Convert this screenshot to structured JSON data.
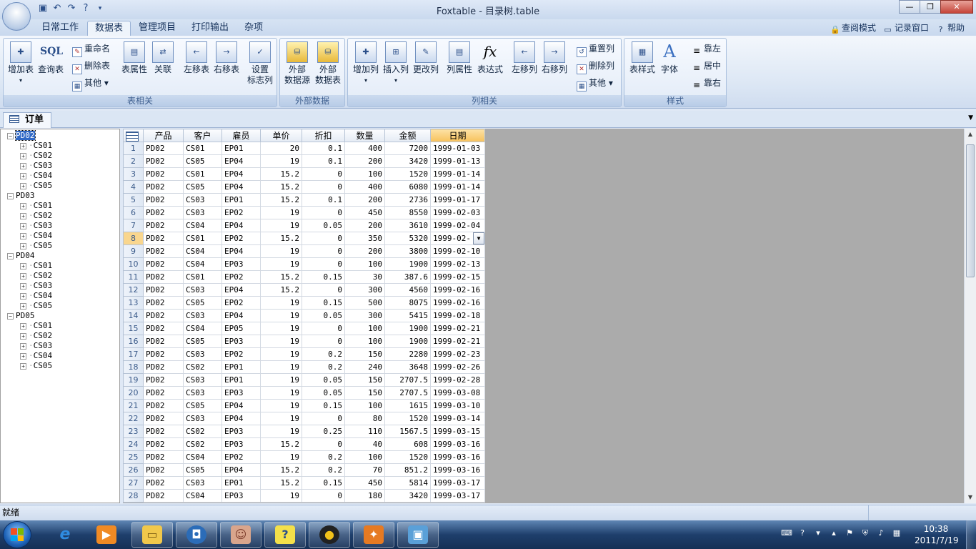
{
  "window": {
    "title": "Foxtable - 目录树.table",
    "minimize_label": "—",
    "maximize_label": "❐",
    "close_label": "✕"
  },
  "ribbon_tabs": [
    "日常工作",
    "数据表",
    "管理项目",
    "打印输出",
    "杂项"
  ],
  "active_tab": "数据表",
  "ribbon_right": {
    "query_mode": "查阅模式",
    "log_window": "记录窗口",
    "help": "帮助"
  },
  "groups": {
    "table": {
      "caption": "表相关",
      "add_table": "增加表",
      "query_table": "查询表",
      "sql_label": "SQL",
      "rename": "重命名",
      "delete_table": "删除表",
      "other": "其他",
      "table_props": "表属性",
      "relation": "关联",
      "move_left": "左移表",
      "move_right": "右移表",
      "set_flag_col": "设置\n标志列"
    },
    "external": {
      "caption": "外部数据",
      "ext_source": "外部\n数据源",
      "ext_table": "外部\n数据表"
    },
    "columns": {
      "caption": "列相关",
      "add_col": "增加列",
      "insert_col": "插入列",
      "change_col": "更改列",
      "col_props": "列属性",
      "expression": "表达式",
      "fx_label": "fx",
      "move_col_left": "左移列",
      "move_col_right": "右移列",
      "reset_col": "重置列",
      "delete_col": "删除列",
      "other": "其他"
    },
    "style": {
      "caption": "样式",
      "table_style": "表样式",
      "font": "字体",
      "font_glyph": "A",
      "align_left": "靠左",
      "align_center": "居中",
      "align_right": "靠右"
    }
  },
  "doc_tab": "订单",
  "tree": [
    {
      "label": "PD02",
      "selected": true,
      "children": [
        "CS01",
        "CS02",
        "CS03",
        "CS04",
        "CS05"
      ]
    },
    {
      "label": "PD03",
      "selected": false,
      "children": [
        "CS01",
        "CS02",
        "CS03",
        "CS04",
        "CS05"
      ]
    },
    {
      "label": "PD04",
      "selected": false,
      "children": [
        "CS01",
        "CS02",
        "CS03",
        "CS04",
        "CS05"
      ]
    },
    {
      "label": "PD05",
      "selected": false,
      "children": [
        "CS01",
        "CS02",
        "CS03",
        "CS04",
        "CS05"
      ]
    }
  ],
  "table": {
    "columns": [
      "产品",
      "客户",
      "雇员",
      "单价",
      "折扣",
      "数量",
      "金额",
      "日期"
    ],
    "selected_column": "日期",
    "current_row": 8,
    "rows": [
      [
        "PD02",
        "CS01",
        "EP01",
        "20",
        "0.1",
        "400",
        "7200",
        "1999-01-03"
      ],
      [
        "PD02",
        "CS05",
        "EP04",
        "19",
        "0.1",
        "200",
        "3420",
        "1999-01-13"
      ],
      [
        "PD02",
        "CS01",
        "EP04",
        "15.2",
        "0",
        "100",
        "1520",
        "1999-01-14"
      ],
      [
        "PD02",
        "CS05",
        "EP04",
        "15.2",
        "0",
        "400",
        "6080",
        "1999-01-14"
      ],
      [
        "PD02",
        "CS03",
        "EP01",
        "15.2",
        "0.1",
        "200",
        "2736",
        "1999-01-17"
      ],
      [
        "PD02",
        "CS03",
        "EP02",
        "19",
        "0",
        "450",
        "8550",
        "1999-02-03"
      ],
      [
        "PD02",
        "CS04",
        "EP04",
        "19",
        "0.05",
        "200",
        "3610",
        "1999-02-04"
      ],
      [
        "PD02",
        "CS01",
        "EP02",
        "15.2",
        "0",
        "350",
        "5320",
        "1999-02-"
      ],
      [
        "PD02",
        "CS04",
        "EP04",
        "19",
        "0",
        "200",
        "3800",
        "1999-02-10"
      ],
      [
        "PD02",
        "CS04",
        "EP03",
        "19",
        "0",
        "100",
        "1900",
        "1999-02-13"
      ],
      [
        "PD02",
        "CS01",
        "EP02",
        "15.2",
        "0.15",
        "30",
        "387.6",
        "1999-02-15"
      ],
      [
        "PD02",
        "CS03",
        "EP04",
        "15.2",
        "0",
        "300",
        "4560",
        "1999-02-16"
      ],
      [
        "PD02",
        "CS05",
        "EP02",
        "19",
        "0.15",
        "500",
        "8075",
        "1999-02-16"
      ],
      [
        "PD02",
        "CS03",
        "EP04",
        "19",
        "0.05",
        "300",
        "5415",
        "1999-02-18"
      ],
      [
        "PD02",
        "CS04",
        "EP05",
        "19",
        "0",
        "100",
        "1900",
        "1999-02-21"
      ],
      [
        "PD02",
        "CS05",
        "EP03",
        "19",
        "0",
        "100",
        "1900",
        "1999-02-21"
      ],
      [
        "PD02",
        "CS03",
        "EP02",
        "19",
        "0.2",
        "150",
        "2280",
        "1999-02-23"
      ],
      [
        "PD02",
        "CS02",
        "EP01",
        "19",
        "0.2",
        "240",
        "3648",
        "1999-02-26"
      ],
      [
        "PD02",
        "CS03",
        "EP01",
        "19",
        "0.05",
        "150",
        "2707.5",
        "1999-02-28"
      ],
      [
        "PD02",
        "CS03",
        "EP03",
        "19",
        "0.05",
        "150",
        "2707.5",
        "1999-03-08"
      ],
      [
        "PD02",
        "CS05",
        "EP04",
        "19",
        "0.15",
        "100",
        "1615",
        "1999-03-10"
      ],
      [
        "PD02",
        "CS03",
        "EP04",
        "19",
        "0",
        "80",
        "1520",
        "1999-03-14"
      ],
      [
        "PD02",
        "CS02",
        "EP03",
        "19",
        "0.25",
        "110",
        "1567.5",
        "1999-03-15"
      ],
      [
        "PD02",
        "CS02",
        "EP03",
        "15.2",
        "0",
        "40",
        "608",
        "1999-03-16"
      ],
      [
        "PD02",
        "CS04",
        "EP02",
        "19",
        "0.2",
        "100",
        "1520",
        "1999-03-16"
      ],
      [
        "PD02",
        "CS05",
        "EP04",
        "15.2",
        "0.2",
        "70",
        "851.2",
        "1999-03-16"
      ],
      [
        "PD02",
        "CS03",
        "EP01",
        "15.2",
        "0.15",
        "450",
        "5814",
        "1999-03-17"
      ],
      [
        "PD02",
        "CS04",
        "EP03",
        "19",
        "0",
        "180",
        "3420",
        "1999-03-17"
      ]
    ]
  },
  "status": {
    "text": "就绪"
  },
  "clock": {
    "time": "10:38",
    "date": "2011/7/19"
  },
  "taskbar_icons": [
    "ie-icon",
    "media-player-icon",
    "explorer-icon",
    "app-icon",
    "photo-icon",
    "help-icon",
    "qq-icon",
    "foxtable-icon",
    "screen-icon"
  ]
}
